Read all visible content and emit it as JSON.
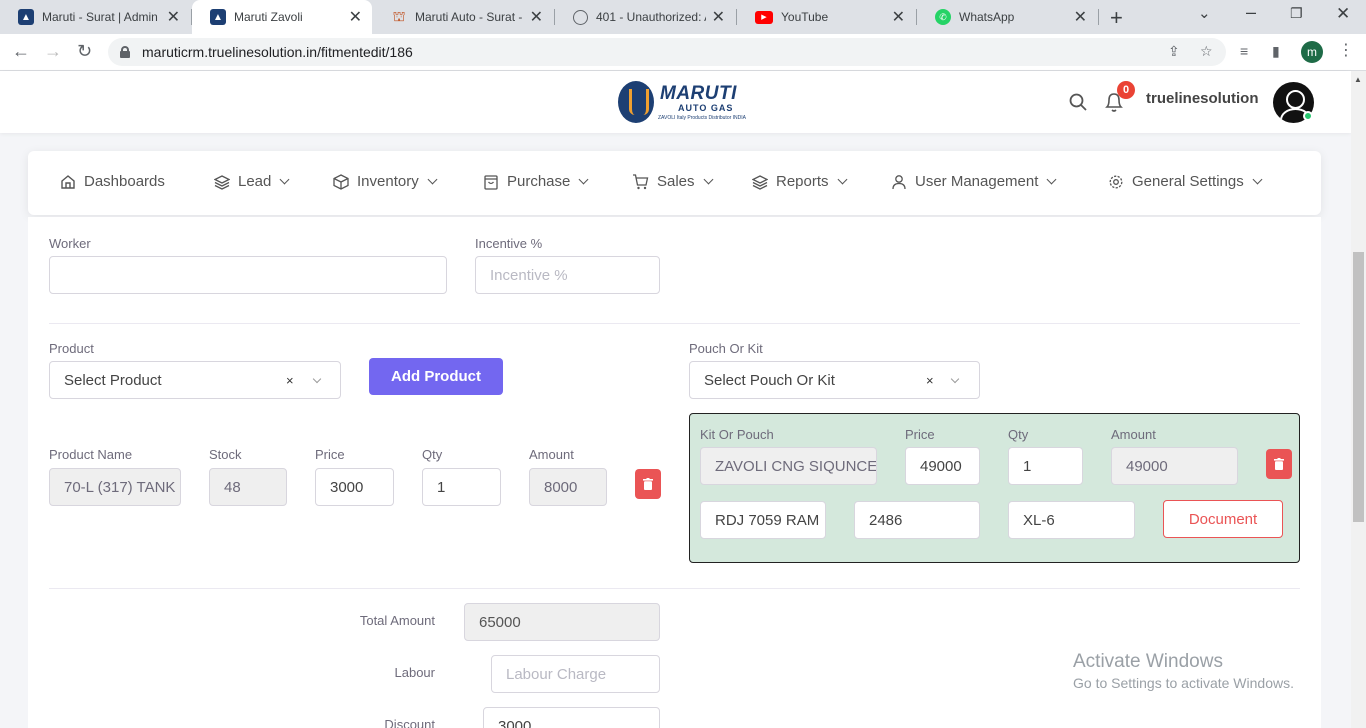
{
  "browser": {
    "tabs": [
      {
        "title": "Maruti - Surat | Admin",
        "icon": "maruti-favicon"
      },
      {
        "title": "Maruti Zavoli",
        "icon": "maruti-favicon"
      },
      {
        "title": "Maruti Auto - Surat - I",
        "icon": "maruti-auto-favicon"
      },
      {
        "title": "401 - Unauthorized: A",
        "icon": "globe-icon"
      },
      {
        "title": "YouTube",
        "icon": "youtube-icon"
      },
      {
        "title": "WhatsApp",
        "icon": "whatsapp-icon"
      }
    ],
    "url": "maruticrm.truelinesolution.in/fitmentedit/186",
    "profile_initial": "m"
  },
  "header": {
    "logo_text": "MARUTI",
    "logo_sub": "AUTO GAS",
    "logo_tagline": "ZAVOLI Italy Products Distributor INDIA",
    "notification_count": "0",
    "username": "truelinesolution"
  },
  "nav": {
    "items": [
      {
        "label": "Dashboards",
        "icon": "home-icon"
      },
      {
        "label": "Lead",
        "icon": "layers-icon"
      },
      {
        "label": "Inventory",
        "icon": "box-icon"
      },
      {
        "label": "Purchase",
        "icon": "shopping-bag-icon"
      },
      {
        "label": "Sales",
        "icon": "cart-icon"
      },
      {
        "label": "Reports",
        "icon": "layers-icon"
      },
      {
        "label": "User Management",
        "icon": "user-icon"
      },
      {
        "label": "General Settings",
        "icon": "gear-icon"
      }
    ]
  },
  "form": {
    "worker_label": "Worker",
    "worker_value": "",
    "incentive_label": "Incentive %",
    "incentive_placeholder": "Incentive %",
    "product_label": "Product",
    "product_placeholder": "Select Product",
    "add_product": "Add Product",
    "pouch_label": "Pouch Or Kit",
    "pouch_placeholder": "Select Pouch Or Kit",
    "clear_symbol": "×",
    "product_row": {
      "headers": {
        "name": "Product Name",
        "stock": "Stock",
        "price": "Price",
        "qty": "Qty",
        "amount": "Amount"
      },
      "name": "70-L (317) TANK",
      "stock": "48",
      "price": "3000",
      "qty": "1",
      "amount": "8000"
    },
    "kit_row": {
      "headers": {
        "name": "Kit Or Pouch",
        "price": "Price",
        "qty": "Qty",
        "amount": "Amount"
      },
      "name": "ZAVOLI CNG SIQUNCE",
      "price": "49000",
      "qty": "1",
      "amount": "49000",
      "serial1": "RDJ 7059 RAM",
      "serial2": "2486",
      "serial3": "XL-6",
      "document_button": "Document"
    },
    "total_amount_label": "Total Amount",
    "total_amount": "65000",
    "labour_label": "Labour",
    "labour_placeholder": "Labour Charge",
    "discount_label": "Discount",
    "discount_value": "3000"
  },
  "watermark": {
    "line1": "Activate Windows",
    "line2": "Go to Settings to activate Windows."
  },
  "colors": {
    "primary": "#7367f0",
    "danger": "#ea5455",
    "kit_bg": "#d4e8dc"
  }
}
